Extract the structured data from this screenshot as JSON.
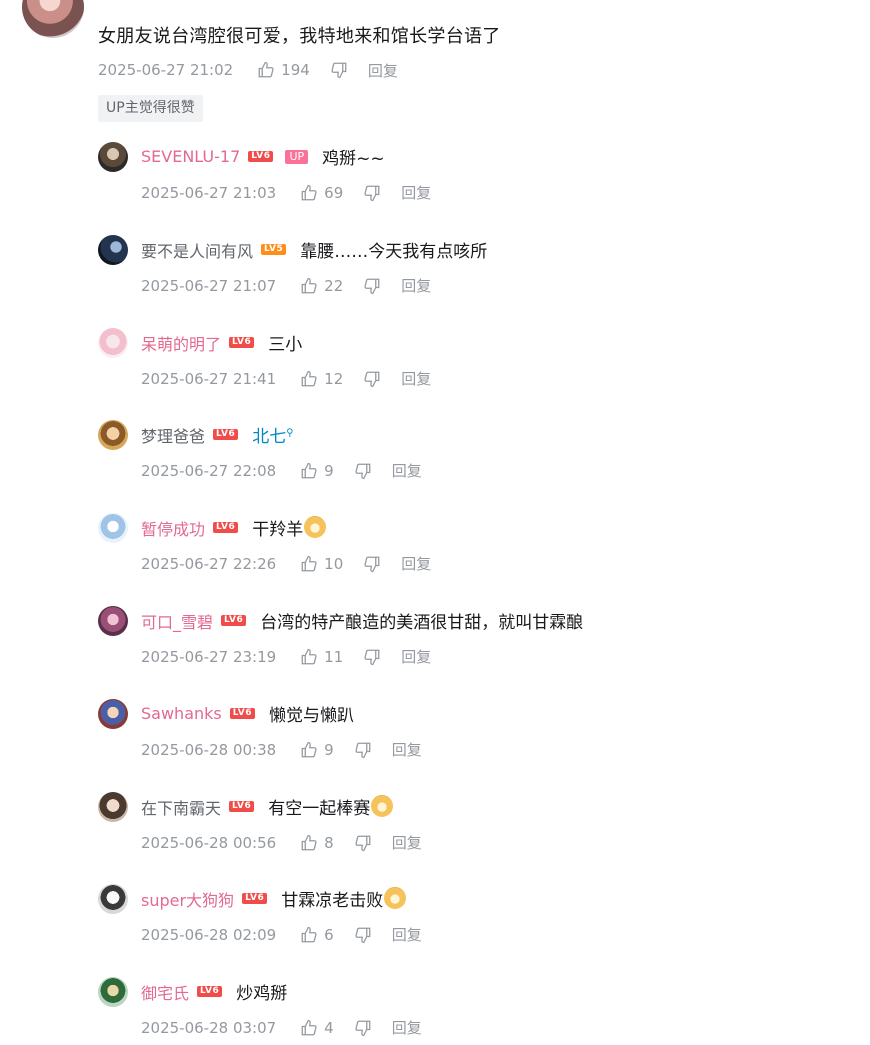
{
  "main": {
    "partial_name": "...",
    "content": "女朋友说台湾腔很可爱，我特地来和馆长学台语了",
    "time": "2025-06-27 21:02",
    "likes": "194",
    "reply_label": "回复",
    "badge": "UP主觉得很赞"
  },
  "replies": [
    {
      "name": "SEVENLU-17",
      "name_color": "pink",
      "level": "LV6",
      "up": "UP",
      "text": "鸡掰~~",
      "time": "2025-06-27 21:03",
      "likes": "69",
      "reply_label": "回复"
    },
    {
      "name": "要不是人间有风",
      "name_color": "gray",
      "level": "LV5",
      "text": "靠腰……今天我有点咳所",
      "time": "2025-06-27 21:07",
      "likes": "22",
      "reply_label": "回复"
    },
    {
      "name": "呆萌的明了",
      "name_color": "pink",
      "level": "LV6",
      "text": "三小",
      "time": "2025-06-27 21:41",
      "likes": "12",
      "reply_label": "回复"
    },
    {
      "name": "梦理爸爸",
      "name_color": "gray",
      "level": "LV6",
      "link": "北七",
      "time": "2025-06-27 22:08",
      "likes": "9",
      "reply_label": "回复"
    },
    {
      "name": "暂停成功",
      "name_color": "pink",
      "level": "LV6",
      "text": "干羚羊",
      "emoji": "doge",
      "time": "2025-06-27 22:26",
      "likes": "10",
      "reply_label": "回复"
    },
    {
      "name": "可口_雪碧",
      "name_color": "pink",
      "level": "LV6",
      "text": "台湾的特产酿造的美酒很甘甜，就叫甘霖酿",
      "time": "2025-06-27 23:19",
      "likes": "11",
      "reply_label": "回复"
    },
    {
      "name": "Sawhanks",
      "name_color": "pink",
      "level": "LV6",
      "text": "懒觉与懒趴",
      "time": "2025-06-28 00:38",
      "likes": "9",
      "reply_label": "回复"
    },
    {
      "name": "在下南霸天",
      "name_color": "gray",
      "level": "LV6",
      "text": "有空一起棒赛",
      "emoji": "doge",
      "time": "2025-06-28 00:56",
      "likes": "8",
      "reply_label": "回复"
    },
    {
      "name": "super大狗狗",
      "name_color": "pink",
      "level": "LV6",
      "text": "甘霖凉老击败",
      "emoji": "doge",
      "time": "2025-06-28 02:09",
      "likes": "6",
      "reply_label": "回复"
    },
    {
      "name": "御宅氏",
      "name_color": "pink",
      "level": "LV6",
      "text": "炒鸡掰",
      "time": "2025-06-28 03:07",
      "likes": "4",
      "reply_label": "回复"
    }
  ],
  "colors": {
    "pink_name": "#e3698f",
    "gray_name": "#61666d",
    "meta": "#9499a0",
    "link": "#008ac5",
    "lv6": "#f04c49",
    "lv5": "#ff8d1a"
  }
}
